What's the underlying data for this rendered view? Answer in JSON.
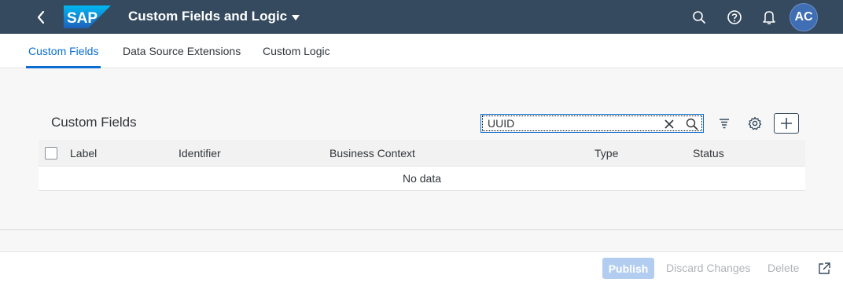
{
  "shell": {
    "logo_text": "SAP",
    "app_title": "Custom Fields and Logic",
    "avatar_initials": "AC",
    "icons": [
      "back-icon",
      "search-icon",
      "help-icon",
      "bell-icon"
    ]
  },
  "tabs": [
    {
      "label": "Custom Fields",
      "active": true
    },
    {
      "label": "Data Source Extensions",
      "active": false
    },
    {
      "label": "Custom Logic",
      "active": false
    }
  ],
  "panel": {
    "title": "Custom Fields",
    "search_value": "UUID"
  },
  "table": {
    "columns": [
      "Label",
      "Identifier",
      "Business Context",
      "Type",
      "Status"
    ],
    "empty_text": "No data"
  },
  "footer": {
    "publish": "Publish",
    "discard": "Discard Changes",
    "delete": "Delete"
  },
  "colors": {
    "shell_bg": "#354a5f",
    "accent": "#0a6ed1",
    "avatar_bg": "#3f6eb5",
    "publish_disabled": "#b3cdf0"
  }
}
